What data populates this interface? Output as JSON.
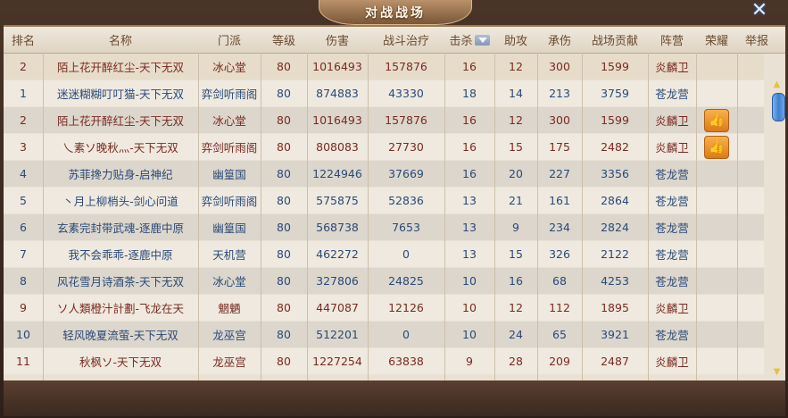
{
  "window": {
    "title": "对战战场",
    "close_symbol": "✕"
  },
  "columns": [
    "排名",
    "名称",
    "门派",
    "等级",
    "伤害",
    "战斗治疗",
    "击杀",
    "助攻",
    "承伤",
    "战场贡献",
    "阵营",
    "荣耀",
    "举报"
  ],
  "rows": [
    {
      "rank": "2",
      "name": "陌上花开醉红尘-天下无双",
      "sect": "冰心堂",
      "level": "80",
      "damage": "1016493",
      "heal": "157876",
      "kills": "16",
      "assists": "12",
      "taken": "300",
      "contrib": "1599",
      "faction": "炎麟卫",
      "liked": false,
      "style": "first flame"
    },
    {
      "rank": "1",
      "name": "迷迷糊糊叮叮猫-天下无双",
      "sect": "弈剑听雨阁",
      "level": "80",
      "damage": "874883",
      "heal": "43330",
      "kills": "18",
      "assists": "14",
      "taken": "213",
      "contrib": "3759",
      "faction": "苍龙营",
      "liked": false,
      "style": "odd dragon"
    },
    {
      "rank": "2",
      "name": "陌上花开醉红尘-天下无双",
      "sect": "冰心堂",
      "level": "80",
      "damage": "1016493",
      "heal": "157876",
      "kills": "16",
      "assists": "12",
      "taken": "300",
      "contrib": "1599",
      "faction": "炎麟卫",
      "liked": true,
      "style": "even flame"
    },
    {
      "rank": "3",
      "name": "乀素ソ晚秋灬-天下无双",
      "sect": "弈剑听雨阁",
      "level": "80",
      "damage": "808083",
      "heal": "27730",
      "kills": "16",
      "assists": "15",
      "taken": "175",
      "contrib": "2482",
      "faction": "炎麟卫",
      "liked": true,
      "style": "odd flame"
    },
    {
      "rank": "4",
      "name": "苏菲搀力贴身-启神纪",
      "sect": "幽篁国",
      "level": "80",
      "damage": "1224946",
      "heal": "37669",
      "kills": "16",
      "assists": "20",
      "taken": "227",
      "contrib": "3356",
      "faction": "苍龙营",
      "liked": false,
      "style": "even dragon"
    },
    {
      "rank": "5",
      "name": "丶月上柳梢头-剑心问道",
      "sect": "弈剑听雨阁",
      "level": "80",
      "damage": "575875",
      "heal": "52836",
      "kills": "13",
      "assists": "21",
      "taken": "161",
      "contrib": "2864",
      "faction": "苍龙营",
      "liked": false,
      "style": "odd dragon"
    },
    {
      "rank": "6",
      "name": "玄素完封带武魂-逐鹿中原",
      "sect": "幽篁国",
      "level": "80",
      "damage": "568738",
      "heal": "7653",
      "kills": "13",
      "assists": "9",
      "taken": "234",
      "contrib": "2824",
      "faction": "苍龙营",
      "liked": false,
      "style": "even dragon"
    },
    {
      "rank": "7",
      "name": "我不会乖乖-逐鹿中原",
      "sect": "天机营",
      "level": "80",
      "damage": "462272",
      "heal": "0",
      "kills": "13",
      "assists": "15",
      "taken": "326",
      "contrib": "2122",
      "faction": "苍龙营",
      "liked": false,
      "style": "odd dragon"
    },
    {
      "rank": "8",
      "name": "风花雪月诗酒茶-天下无双",
      "sect": "冰心堂",
      "level": "80",
      "damage": "327806",
      "heal": "24825",
      "kills": "10",
      "assists": "16",
      "taken": "68",
      "contrib": "4253",
      "faction": "苍龙营",
      "liked": false,
      "style": "even dragon"
    },
    {
      "rank": "9",
      "name": "ソ人類橙汁計劃-飞龙在天",
      "sect": "魍魉",
      "level": "80",
      "damage": "447087",
      "heal": "12126",
      "kills": "10",
      "assists": "12",
      "taken": "112",
      "contrib": "1895",
      "faction": "炎麟卫",
      "liked": false,
      "style": "odd flame"
    },
    {
      "rank": "10",
      "name": "轻风晚夏流萤-天下无双",
      "sect": "龙巫宫",
      "level": "80",
      "damage": "512201",
      "heal": "0",
      "kills": "10",
      "assists": "24",
      "taken": "65",
      "contrib": "3921",
      "faction": "苍龙营",
      "liked": false,
      "style": "even dragon"
    },
    {
      "rank": "11",
      "name": "秋枫ソ-天下无双",
      "sect": "龙巫宫",
      "level": "80",
      "damage": "1227254",
      "heal": "63838",
      "kills": "9",
      "assists": "28",
      "taken": "209",
      "contrib": "2487",
      "faction": "炎麟卫",
      "liked": false,
      "style": "odd flame"
    }
  ],
  "like_icon": "thumbs-up-icon",
  "like_glyph": "👍",
  "scroll": {
    "up_glyph": "▲",
    "down_glyph": "▼"
  }
}
